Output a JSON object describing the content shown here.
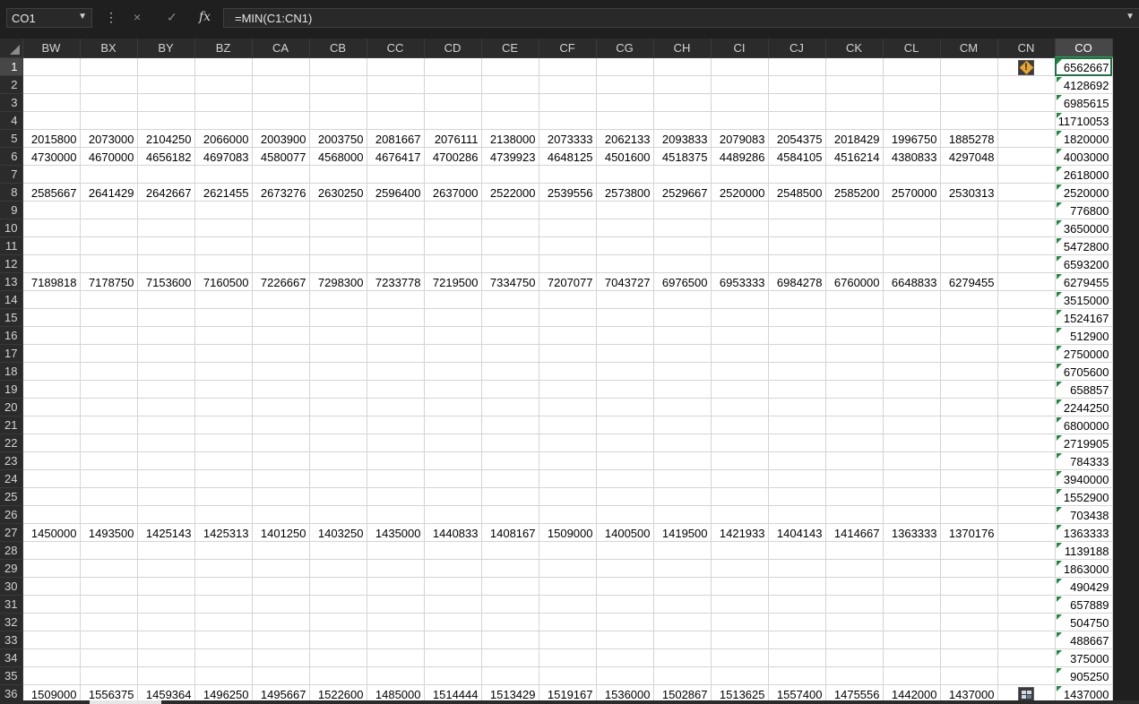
{
  "formula_bar": {
    "name_box": "CO1",
    "formula": "=MIN(C1:CN1)",
    "cancel_icon": "×",
    "enter_icon": "✓",
    "fx_icon": "fx",
    "more_icon": "⋮"
  },
  "sheet": {
    "columns": [
      "BW",
      "BX",
      "BY",
      "BZ",
      "CA",
      "CB",
      "CC",
      "CD",
      "CE",
      "CF",
      "CG",
      "CH",
      "CI",
      "CJ",
      "CK",
      "CL",
      "CM",
      "CN",
      "CO"
    ],
    "selected_column": "CO",
    "selected_row": 1,
    "rows": [
      {
        "n": "1",
        "cells": [
          "",
          "",
          "",
          "",
          "",
          "",
          "",
          "",
          "",
          "",
          "",
          "",
          "",
          "",
          "",
          "",
          "",
          "",
          "6562667"
        ]
      },
      {
        "n": "2",
        "cells": [
          "",
          "",
          "",
          "",
          "",
          "",
          "",
          "",
          "",
          "",
          "",
          "",
          "",
          "",
          "",
          "",
          "",
          "",
          "4128692"
        ]
      },
      {
        "n": "3",
        "cells": [
          "",
          "",
          "",
          "",
          "",
          "",
          "",
          "",
          "",
          "",
          "",
          "",
          "",
          "",
          "",
          "",
          "",
          "",
          "6985615"
        ]
      },
      {
        "n": "4",
        "cells": [
          "",
          "",
          "",
          "",
          "",
          "",
          "",
          "",
          "",
          "",
          "",
          "",
          "",
          "",
          "",
          "",
          "",
          "",
          "11710053"
        ]
      },
      {
        "n": "5",
        "cells": [
          "2015800",
          "2073000",
          "2104250",
          "2066000",
          "2003900",
          "2003750",
          "2081667",
          "2076111",
          "2138000",
          "2073333",
          "2062133",
          "2093833",
          "2079083",
          "2054375",
          "2018429",
          "1996750",
          "1885278",
          "",
          "1820000"
        ]
      },
      {
        "n": "6",
        "cells": [
          "4730000",
          "4670000",
          "4656182",
          "4697083",
          "4580077",
          "4568000",
          "4676417",
          "4700286",
          "4739923",
          "4648125",
          "4501600",
          "4518375",
          "4489286",
          "4584105",
          "4516214",
          "4380833",
          "4297048",
          "",
          "4003000"
        ]
      },
      {
        "n": "7",
        "cells": [
          "",
          "",
          "",
          "",
          "",
          "",
          "",
          "",
          "",
          "",
          "",
          "",
          "",
          "",
          "",
          "",
          "",
          "",
          "2618000"
        ]
      },
      {
        "n": "8",
        "cells": [
          "2585667",
          "2641429",
          "2642667",
          "2621455",
          "2673276",
          "2630250",
          "2596400",
          "2637000",
          "2522000",
          "2539556",
          "2573800",
          "2529667",
          "2520000",
          "2548500",
          "2585200",
          "2570000",
          "2530313",
          "",
          "2520000"
        ]
      },
      {
        "n": "9",
        "cells": [
          "",
          "",
          "",
          "",
          "",
          "",
          "",
          "",
          "",
          "",
          "",
          "",
          "",
          "",
          "",
          "",
          "",
          "",
          "776800"
        ]
      },
      {
        "n": "10",
        "cells": [
          "",
          "",
          "",
          "",
          "",
          "",
          "",
          "",
          "",
          "",
          "",
          "",
          "",
          "",
          "",
          "",
          "",
          "",
          "3650000"
        ]
      },
      {
        "n": "11",
        "cells": [
          "",
          "",
          "",
          "",
          "",
          "",
          "",
          "",
          "",
          "",
          "",
          "",
          "",
          "",
          "",
          "",
          "",
          "",
          "5472800"
        ]
      },
      {
        "n": "12",
        "cells": [
          "",
          "",
          "",
          "",
          "",
          "",
          "",
          "",
          "",
          "",
          "",
          "",
          "",
          "",
          "",
          "",
          "",
          "",
          "6593200"
        ]
      },
      {
        "n": "13",
        "cells": [
          "7189818",
          "7178750",
          "7153600",
          "7160500",
          "7226667",
          "7298300",
          "7233778",
          "7219500",
          "7334750",
          "7207077",
          "7043727",
          "6976500",
          "6953333",
          "6984278",
          "6760000",
          "6648833",
          "6279455",
          "",
          "6279455"
        ]
      },
      {
        "n": "14",
        "cells": [
          "",
          "",
          "",
          "",
          "",
          "",
          "",
          "",
          "",
          "",
          "",
          "",
          "",
          "",
          "",
          "",
          "",
          "",
          "3515000"
        ]
      },
      {
        "n": "15",
        "cells": [
          "",
          "",
          "",
          "",
          "",
          "",
          "",
          "",
          "",
          "",
          "",
          "",
          "",
          "",
          "",
          "",
          "",
          "",
          "1524167"
        ]
      },
      {
        "n": "16",
        "cells": [
          "",
          "",
          "",
          "",
          "",
          "",
          "",
          "",
          "",
          "",
          "",
          "",
          "",
          "",
          "",
          "",
          "",
          "",
          "512900"
        ]
      },
      {
        "n": "17",
        "cells": [
          "",
          "",
          "",
          "",
          "",
          "",
          "",
          "",
          "",
          "",
          "",
          "",
          "",
          "",
          "",
          "",
          "",
          "",
          "2750000"
        ]
      },
      {
        "n": "18",
        "cells": [
          "",
          "",
          "",
          "",
          "",
          "",
          "",
          "",
          "",
          "",
          "",
          "",
          "",
          "",
          "",
          "",
          "",
          "",
          "6705600"
        ]
      },
      {
        "n": "19",
        "cells": [
          "",
          "",
          "",
          "",
          "",
          "",
          "",
          "",
          "",
          "",
          "",
          "",
          "",
          "",
          "",
          "",
          "",
          "",
          "658857"
        ]
      },
      {
        "n": "20",
        "cells": [
          "",
          "",
          "",
          "",
          "",
          "",
          "",
          "",
          "",
          "",
          "",
          "",
          "",
          "",
          "",
          "",
          "",
          "",
          "2244250"
        ]
      },
      {
        "n": "21",
        "cells": [
          "",
          "",
          "",
          "",
          "",
          "",
          "",
          "",
          "",
          "",
          "",
          "",
          "",
          "",
          "",
          "",
          "",
          "",
          "6800000"
        ]
      },
      {
        "n": "22",
        "cells": [
          "",
          "",
          "",
          "",
          "",
          "",
          "",
          "",
          "",
          "",
          "",
          "",
          "",
          "",
          "",
          "",
          "",
          "",
          "2719905"
        ]
      },
      {
        "n": "23",
        "cells": [
          "",
          "",
          "",
          "",
          "",
          "",
          "",
          "",
          "",
          "",
          "",
          "",
          "",
          "",
          "",
          "",
          "",
          "",
          "784333"
        ]
      },
      {
        "n": "24",
        "cells": [
          "",
          "",
          "",
          "",
          "",
          "",
          "",
          "",
          "",
          "",
          "",
          "",
          "",
          "",
          "",
          "",
          "",
          "",
          "3940000"
        ]
      },
      {
        "n": "25",
        "cells": [
          "",
          "",
          "",
          "",
          "",
          "",
          "",
          "",
          "",
          "",
          "",
          "",
          "",
          "",
          "",
          "",
          "",
          "",
          "1552900"
        ]
      },
      {
        "n": "26",
        "cells": [
          "",
          "",
          "",
          "",
          "",
          "",
          "",
          "",
          "",
          "",
          "",
          "",
          "",
          "",
          "",
          "",
          "",
          "",
          "703438"
        ]
      },
      {
        "n": "27",
        "cells": [
          "1450000",
          "1493500",
          "1425143",
          "1425313",
          "1401250",
          "1403250",
          "1435000",
          "1440833",
          "1408167",
          "1509000",
          "1400500",
          "1419500",
          "1421933",
          "1404143",
          "1414667",
          "1363333",
          "1370176",
          "",
          "1363333"
        ]
      },
      {
        "n": "28",
        "cells": [
          "",
          "",
          "",
          "",
          "",
          "",
          "",
          "",
          "",
          "",
          "",
          "",
          "",
          "",
          "",
          "",
          "",
          "",
          "1139188"
        ]
      },
      {
        "n": "29",
        "cells": [
          "",
          "",
          "",
          "",
          "",
          "",
          "",
          "",
          "",
          "",
          "",
          "",
          "",
          "",
          "",
          "",
          "",
          "",
          "1863000"
        ]
      },
      {
        "n": "30",
        "cells": [
          "",
          "",
          "",
          "",
          "",
          "",
          "",
          "",
          "",
          "",
          "",
          "",
          "",
          "",
          "",
          "",
          "",
          "",
          "490429"
        ]
      },
      {
        "n": "31",
        "cells": [
          "",
          "",
          "",
          "",
          "",
          "",
          "",
          "",
          "",
          "",
          "",
          "",
          "",
          "",
          "",
          "",
          "",
          "",
          "657889"
        ]
      },
      {
        "n": "32",
        "cells": [
          "",
          "",
          "",
          "",
          "",
          "",
          "",
          "",
          "",
          "",
          "",
          "",
          "",
          "",
          "",
          "",
          "",
          "",
          "504750"
        ]
      },
      {
        "n": "33",
        "cells": [
          "",
          "",
          "",
          "",
          "",
          "",
          "",
          "",
          "",
          "",
          "",
          "",
          "",
          "",
          "",
          "",
          "",
          "",
          "488667"
        ]
      },
      {
        "n": "34",
        "cells": [
          "",
          "",
          "",
          "",
          "",
          "",
          "",
          "",
          "",
          "",
          "",
          "",
          "",
          "",
          "",
          "",
          "",
          "",
          "375000"
        ]
      },
      {
        "n": "35",
        "cells": [
          "",
          "",
          "",
          "",
          "",
          "",
          "",
          "",
          "",
          "",
          "",
          "",
          "",
          "",
          "",
          "",
          "",
          "",
          "905250"
        ]
      },
      {
        "n": "36",
        "cells": [
          "1509000",
          "1556375",
          "1459364",
          "1496250",
          "1495667",
          "1522600",
          "1485000",
          "1514444",
          "1513429",
          "1519167",
          "1536000",
          "1502867",
          "1513625",
          "1557400",
          "1475556",
          "1442000",
          "1437000",
          "",
          "1437000"
        ]
      }
    ],
    "warning_icon_row": "1",
    "quick_analysis_icon_row": "36"
  },
  "colors": {
    "accent": "#1e7145",
    "indicator": "#1e8a3e",
    "warning": "#e7a62f"
  }
}
